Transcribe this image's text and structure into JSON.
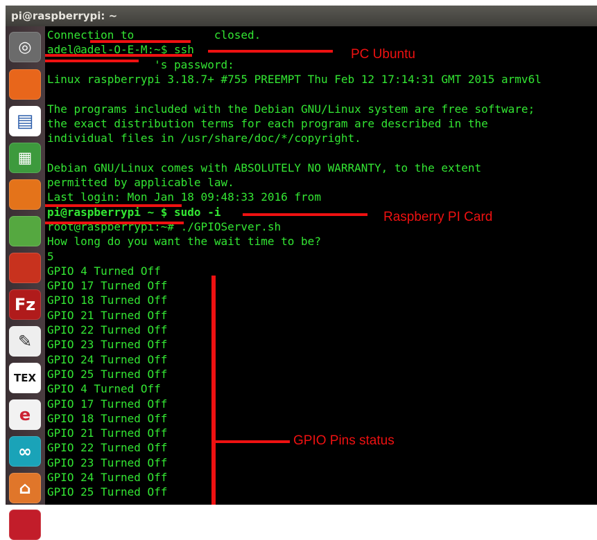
{
  "window": {
    "title": "pi@raspberrypi: ~"
  },
  "launcher": {
    "icons": [
      "ubuntu-dash-icon",
      "firefox-icon",
      "libreoffice-writer-icon",
      "libreoffice-calc-icon",
      "software-center-icon",
      "system-settings-icon",
      "update-manager-icon",
      "filezilla-icon",
      "text-editor-icon",
      "tex-editor-icon",
      "browser-icon",
      "arduino-icon",
      "home-folder-icon",
      "app-icon"
    ],
    "glyphs": [
      "◎",
      "",
      "▤",
      "▦",
      "",
      "",
      "",
      "Fz",
      "✎",
      "TEX",
      "e",
      "∞",
      "⌂",
      ""
    ]
  },
  "terminal": {
    "lines": [
      "Connection to            closed.",
      "adel@adel-O-E-M:~$ ssh",
      "                's password:",
      "Linux raspberrypi 3.18.7+ #755 PREEMPT Thu Feb 12 17:14:31 GMT 2015 armv6l",
      "",
      "The programs included with the Debian GNU/Linux system are free software;",
      "the exact distribution terms for each program are described in the",
      "individual files in /usr/share/doc/*/copyright.",
      "",
      "Debian GNU/Linux comes with ABSOLUTELY NO WARRANTY, to the extent",
      "permitted by applicable law.",
      "Last login: Mon Jan 18 09:48:33 2016 from",
      "pi@raspberrypi ~ $ sudo -i",
      "root@raspberrypi:~# ./GPIOServer.sh",
      "How long do you want the wait time to be?",
      "5",
      "GPIO 4 Turned Off",
      "GPIO 17 Turned Off",
      "GPIO 18 Turned Off",
      "GPIO 21 Turned Off",
      "GPIO 22 Turned Off",
      "GPIO 23 Turned Off",
      "GPIO 24 Turned Off",
      "GPIO 25 Turned Off",
      "GPIO 4 Turned Off",
      "GPIO 17 Turned Off",
      "GPIO 18 Turned Off",
      "GPIO 21 Turned Off",
      "GPIO 22 Turned Off",
      "GPIO 23 Turned Off",
      "GPIO 24 Turned Off",
      "GPIO 25 Turned Off"
    ]
  },
  "annotations": {
    "pc_ubuntu": "PC Ubuntu",
    "raspberry_card": "Raspberry PI Card",
    "gpio_status": "GPIO Pins status"
  },
  "colors": {
    "terminal_text": "#33e633",
    "terminal_bg": "#000000",
    "annotation": "#ee1111"
  }
}
